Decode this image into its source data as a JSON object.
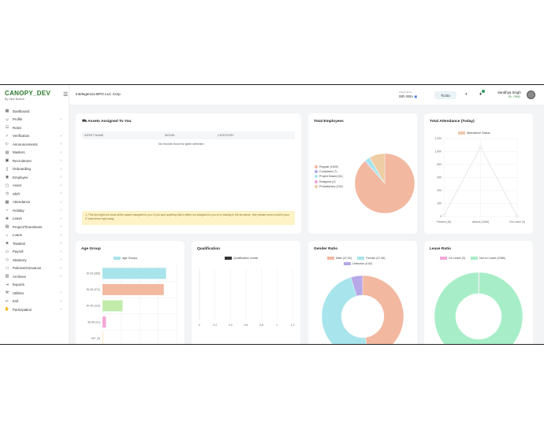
{
  "brand": {
    "name": "CANOPY_DEV",
    "subtitle": "By Olive Branch"
  },
  "sidebar": {
    "items": [
      {
        "label": "Dashboard",
        "icon": "grid-icon",
        "sub": false
      },
      {
        "label": "Profile",
        "icon": "user-icon",
        "sub": true
      },
      {
        "label": "Roles",
        "icon": "people-icon",
        "sub": false
      },
      {
        "label": "Verification",
        "icon": "check-icon",
        "sub": true
      },
      {
        "label": "Announcements",
        "icon": "megaphone-icon",
        "sub": true
      },
      {
        "label": "Masters",
        "icon": "folder-icon",
        "sub": true
      },
      {
        "label": "Recruitment",
        "icon": "briefcase-icon",
        "sub": true
      },
      {
        "label": "Onboarding",
        "icon": "door-icon",
        "sub": true
      },
      {
        "label": "Employee",
        "icon": "badge-icon",
        "sub": true
      },
      {
        "label": "Asset",
        "icon": "box-icon",
        "sub": true
      },
      {
        "label": "Shift",
        "icon": "clock-icon",
        "sub": true
      },
      {
        "label": "Attendance",
        "icon": "calendar-icon",
        "sub": true
      },
      {
        "label": "Holiday",
        "icon": "sun-icon",
        "sub": true
      },
      {
        "label": "Leave",
        "icon": "leaf-icon",
        "sub": true
      },
      {
        "label": "Project/Timesheets",
        "icon": "sheet-icon",
        "sub": true
      },
      {
        "label": "Loans",
        "icon": "bank-icon",
        "sub": true
      },
      {
        "label": "Taxation",
        "icon": "tax-icon",
        "sub": true
      },
      {
        "label": "Payroll",
        "icon": "wallet-icon",
        "sub": true
      },
      {
        "label": "Statutory",
        "icon": "shield-icon",
        "sub": true
      },
      {
        "label": "Policies/Grievance",
        "icon": "doc-icon",
        "sub": true
      },
      {
        "label": "Archives",
        "icon": "archive-icon",
        "sub": true
      },
      {
        "label": "Exports",
        "icon": "export-icon",
        "sub": false
      },
      {
        "label": "Utilities",
        "icon": "tool-icon",
        "sub": true
      },
      {
        "label": "Exit",
        "icon": "exit-icon",
        "sub": true
      },
      {
        "label": "Participation",
        "icon": "hand-icon",
        "sub": true
      }
    ]
  },
  "header": {
    "company": "Intelegencia BPO LLC Corp",
    "clock_label": "Clock Hours",
    "clock_value": "00h 00m",
    "todo_label": "To Do",
    "user_name": "Sandhya Singh",
    "user_id": "ID: 7/900"
  },
  "assets": {
    "title": "Assets Assigned To You",
    "columns": [
      "ASSET NAME",
      "MODEL",
      "CATEGORY"
    ],
    "empty": "No records found for given selection",
    "notice": "⚠ This list might not show all the assets assigned to you. If you spot anything that is either not assigned to you or is missing in the list above, then please send a mail to your IT team there right away."
  },
  "colors": {
    "peach": "#f2b8a0",
    "purple": "#b7a8e8",
    "cyan": "#a8e4ec",
    "pink": "#f3a6d6",
    "tan": "#eecca4",
    "green": "#a9e6b6",
    "mint": "#a7eec8",
    "dark": "#333333"
  },
  "chart_data": [
    {
      "id": "total_employees",
      "type": "pie",
      "title": "Total Employees",
      "legend": [
        "Regular (1609)",
        "Consultant (7)",
        "Project Based (51)",
        "Resigned (2)",
        "Probationary (152)"
      ],
      "categories": [
        "Regular",
        "Consultant",
        "Project Based",
        "Resigned",
        "Probationary"
      ],
      "values": [
        1609,
        7,
        51,
        2,
        152
      ]
    },
    {
      "id": "total_attendance",
      "type": "line",
      "title": "Total Attendance (Today)",
      "series_name": "Attendance Status",
      "categories": [
        "Present (15)",
        "Absent (1066)",
        "On Leave (3)"
      ],
      "values": [
        15,
        1066,
        3
      ],
      "yticks": [
        "0",
        "200",
        "400",
        "600",
        "800",
        "1,000",
        "1,200"
      ],
      "ylim": [
        0,
        1200
      ]
    },
    {
      "id": "age_group",
      "type": "bar",
      "title": "Age Group",
      "orientation": "horizontal",
      "series_name": "Age Groups",
      "categories": [
        "20-29 (386)",
        "30-39 (372)",
        "40-49 (122)",
        "50-59 (21)",
        "60+ (3)"
      ],
      "values": [
        386,
        372,
        122,
        21,
        3
      ]
    },
    {
      "id": "qualification",
      "type": "bar",
      "title": "Qualification",
      "orientation": "horizontal",
      "series_name": "Qualification Levels",
      "categories": [],
      "values": [],
      "xticks": [
        "0",
        "0.2",
        "0.4",
        "0.6",
        "0.8",
        "1",
        "1.2"
      ],
      "xlim": [
        0,
        1.2
      ]
    },
    {
      "id": "gender_ratio",
      "type": "pie",
      "title": "Gender Ratio",
      "donut": true,
      "legend": [
        "Male (47.92)",
        "Female (47.46)",
        "Unknown (4.62)"
      ],
      "categories": [
        "Male",
        "Female",
        "Unknown"
      ],
      "values": [
        47.92,
        47.46,
        4.62
      ]
    },
    {
      "id": "leave_ratio",
      "type": "pie",
      "title": "Leave Ratio",
      "donut": true,
      "legend": [
        "On Leave (3)",
        "Not on Leave (1068)"
      ],
      "categories": [
        "On Leave",
        "Not on Leave"
      ],
      "values": [
        3,
        1068
      ]
    }
  ]
}
